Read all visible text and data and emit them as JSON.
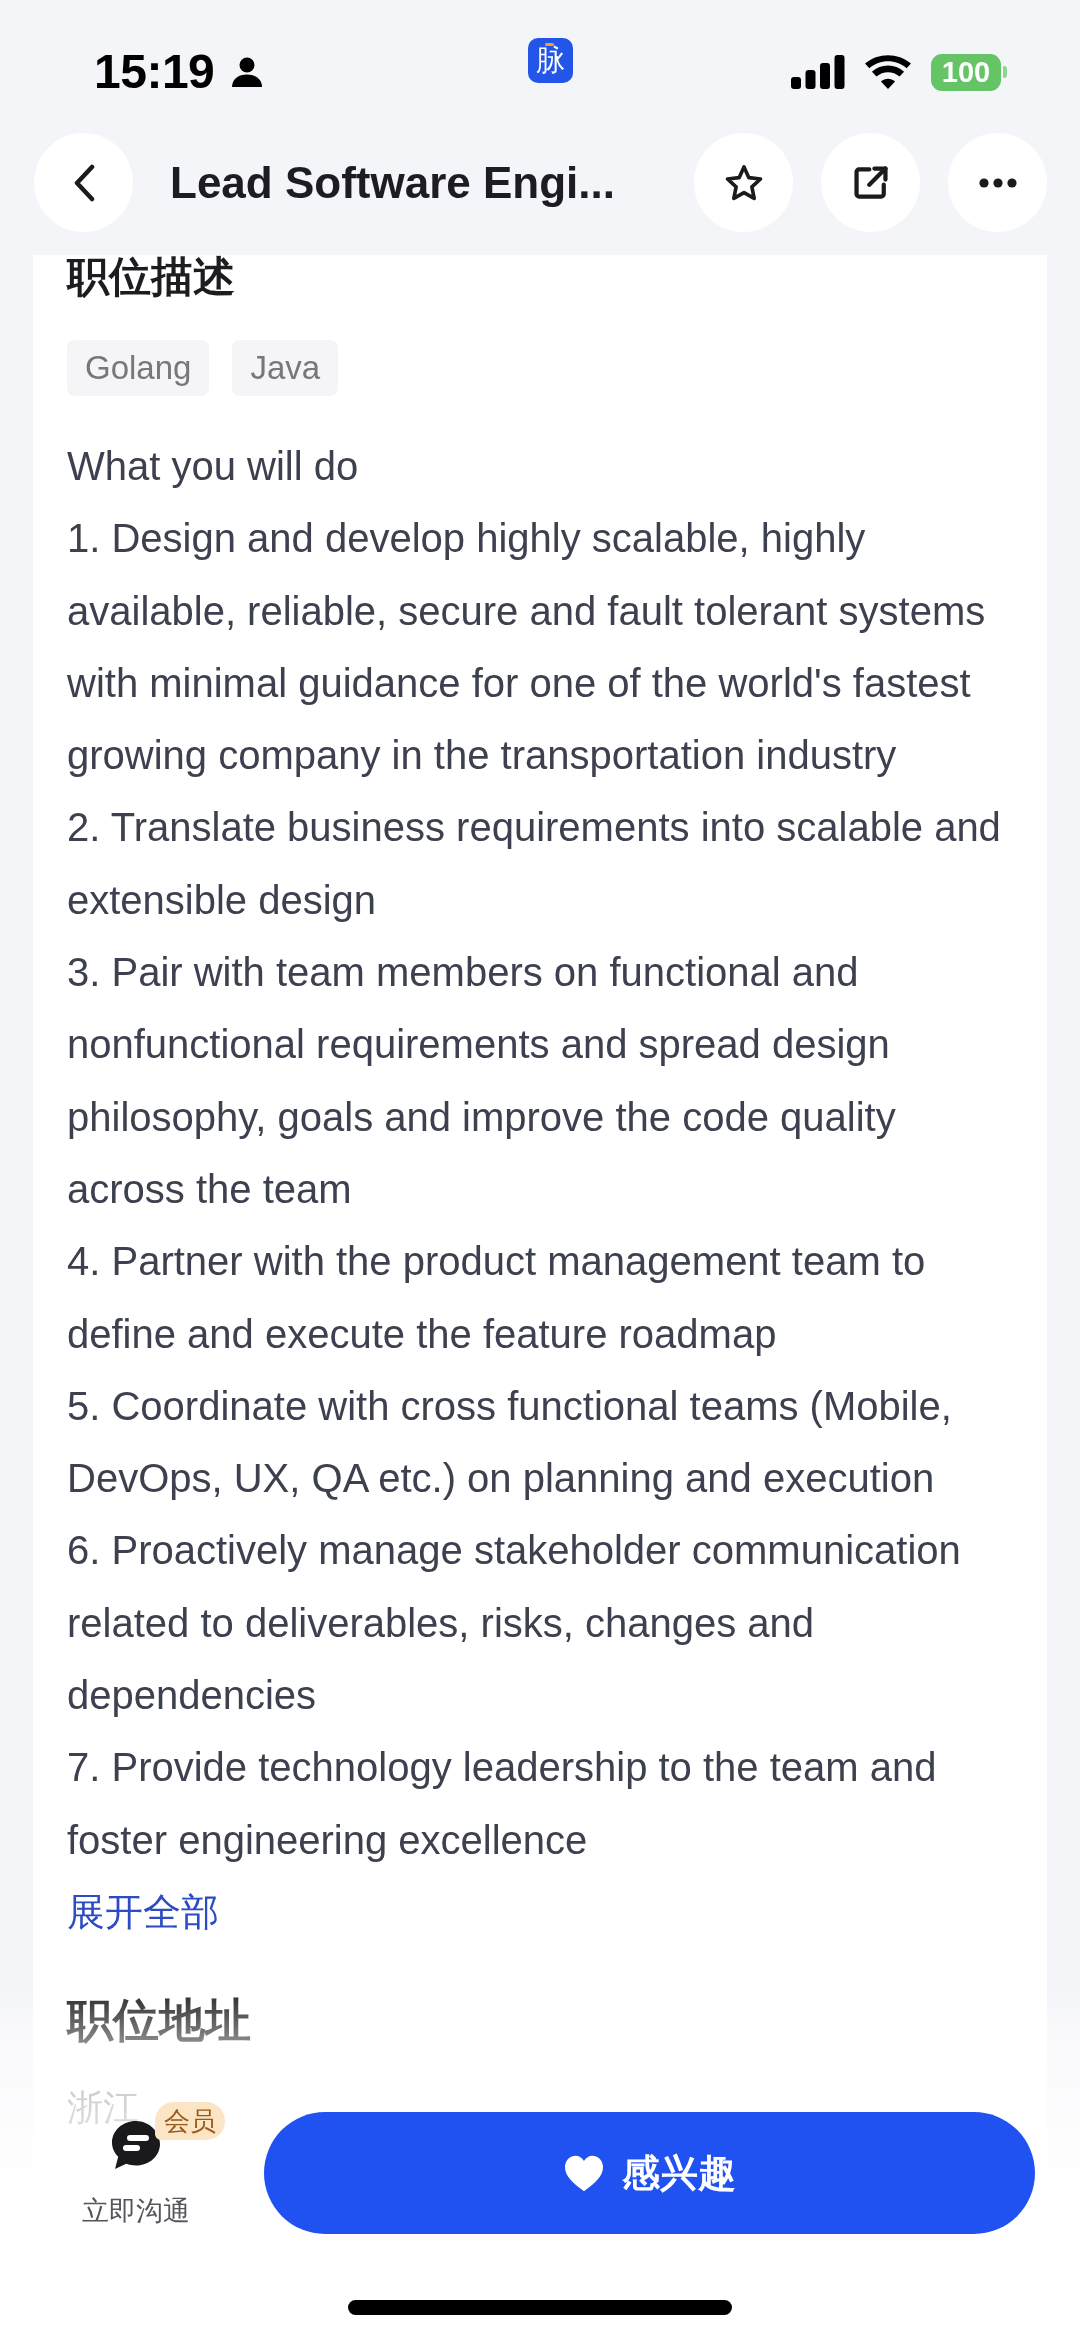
{
  "status_bar": {
    "time": "15:19",
    "app_badge": "脉",
    "battery": "100"
  },
  "header": {
    "title": "Lead Software Engi..."
  },
  "description": {
    "heading": "职位描述",
    "tags": [
      "Golang",
      "Java"
    ],
    "paragraphs": [
      "What you will do",
      "1. Design and develop highly scalable, highly available, reliable, secure and fault tolerant systems with minimal guidance for one of the world's fastest growing company in the transportation industry",
      "2. Translate business requirements into scalable and extensible design",
      "3. Pair with team members on functional and nonfunctional requirements and spread design philosophy, goals and improve the code quality across the team",
      "4. Partner with the product management team to define and execute the feature roadmap",
      "5. Coordinate with cross functional teams (Mobile, DevOps, UX, QA etc.) on planning and execution",
      "6. Proactively manage stakeholder communication related to deliverables, risks, changes and dependencies",
      "7. Provide technology leadership to the team and foster engineering excellence"
    ],
    "expand_link": "展开全部"
  },
  "location": {
    "heading": "职位地址",
    "address": "浙江"
  },
  "bottom_bar": {
    "chat": {
      "label": "立即沟通",
      "badge": "会员"
    },
    "primary_button": "感兴趣"
  }
}
